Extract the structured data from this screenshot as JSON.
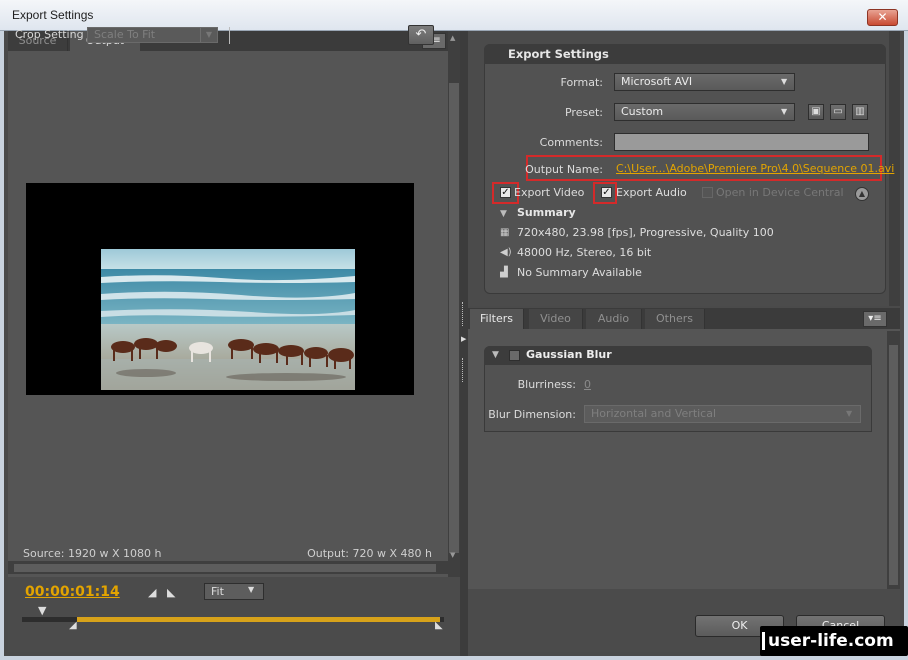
{
  "window": {
    "title": "Export Settings",
    "close_glyph": "✕"
  },
  "left_panel": {
    "tabs": [
      {
        "label": "Source"
      },
      {
        "label": "Output"
      }
    ],
    "menu_icon": "panel-menu-icon",
    "crop_label": "Crop Setting",
    "crop_value": "Scale To Fit",
    "undo_icon": "undo-arrow-icon",
    "source_info": "Source: 1920 w X 1080 h",
    "output_info": "Output: 720 w X 480 h"
  },
  "timeline": {
    "timecode": "00:00:01:14",
    "zoom": "Fit",
    "work_area_color": "#d7a21a"
  },
  "export_settings": {
    "title": "Export Settings",
    "format_label": "Format:",
    "format_value": "Microsoft AVI",
    "preset_label": "Preset:",
    "preset_value": "Custom",
    "comments_label": "Comments:",
    "comments_value": "",
    "output_name_label": "Output Name:",
    "output_name_value": "C:\\User...\\Adobe\\Premiere Pro\\4.0\\Sequence 01.avi",
    "export_video_label": "Export Video",
    "export_video_checked": true,
    "export_audio_label": "Export Audio",
    "export_audio_checked": true,
    "device_central_label": "Open in Device Central",
    "device_central_checked": false,
    "summary_label": "Summary",
    "summary_video": "720x480, 23.98 [fps], Progressive, Quality 100",
    "summary_audio": "48000 Hz, Stereo, 16 bit",
    "summary_other": "No Summary Available",
    "highlight_color": "#d42a2a",
    "link_color": "#e3a400"
  },
  "filters_panel": {
    "tabs": [
      {
        "label": "Filters"
      },
      {
        "label": "Video"
      },
      {
        "label": "Audio"
      },
      {
        "label": "Others"
      }
    ],
    "filter_name": "Gaussian Blur",
    "blurriness_label": "Blurriness:",
    "blurriness_value": "0",
    "blur_dimension_label": "Blur Dimension:",
    "blur_dimension_value": "Horizontal and Vertical"
  },
  "buttons": {
    "ok": "OK",
    "cancel": "Cancel"
  },
  "watermark": "user-life.com"
}
